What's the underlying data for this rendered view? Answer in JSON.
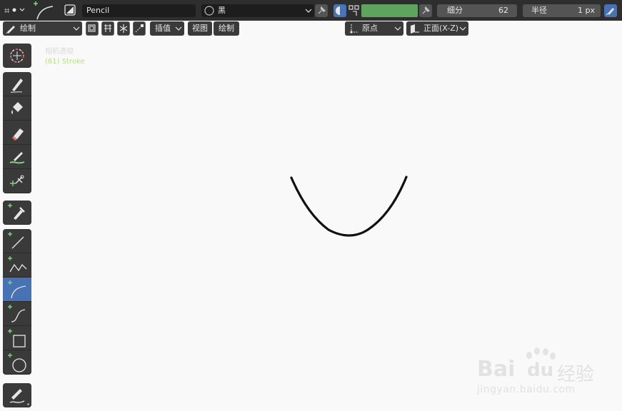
{
  "header": {
    "material_name": "Pencil",
    "color_name": "黑",
    "subdivision_label": "细分",
    "subdivision_value": "62",
    "radius_label": "半径",
    "radius_value": "1 px",
    "accent_color": "#4772b3",
    "active_color_swatch": "#5ea35e"
  },
  "subheader": {
    "mode_label": "绘制",
    "interpolate_label": "插值",
    "view_label": "视图",
    "draw_label": "绘制",
    "origin_label": "原点",
    "view_plane_label": "正面(X-Z)"
  },
  "viewport": {
    "perspective_label": "相机透视",
    "object_label": "(61) Stroke",
    "object_label_color": "#8fc44a"
  },
  "toolbar": {
    "tools": [
      {
        "name": "cursor-tool",
        "icon": "cursor-icon"
      },
      {
        "name": "draw-tool",
        "icon": "pencil-icon"
      },
      {
        "name": "fill-tool",
        "icon": "bucket-icon"
      },
      {
        "name": "erase-tool",
        "icon": "eraser-icon"
      },
      {
        "name": "tint-tool",
        "icon": "tint-icon"
      },
      {
        "name": "cutter-tool",
        "icon": "scissors-icon"
      },
      {
        "name": "eyedropper-tool",
        "icon": "eyedropper-icon"
      },
      {
        "name": "line-tool",
        "icon": "line-icon"
      },
      {
        "name": "polyline-tool",
        "icon": "polyline-icon"
      },
      {
        "name": "arc-tool",
        "icon": "arc-icon",
        "active": true
      },
      {
        "name": "curve-tool",
        "icon": "curve-icon"
      },
      {
        "name": "box-tool",
        "icon": "box-icon"
      },
      {
        "name": "circle-tool",
        "icon": "circle-icon"
      },
      {
        "name": "annotate-tool",
        "icon": "annotate-icon"
      }
    ]
  },
  "watermark": {
    "brand_text": "Bai",
    "brand_text_2": "du",
    "brand_cn": "经验",
    "site": "jingyan.baidu.com"
  }
}
